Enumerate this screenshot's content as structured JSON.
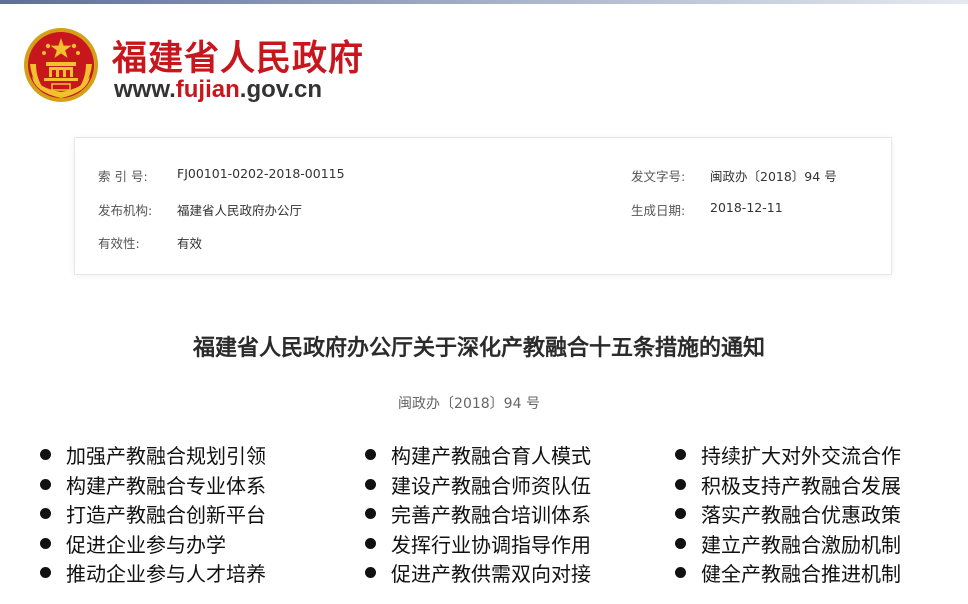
{
  "site": {
    "name": "福建省人民政府",
    "url_prefix": "www.",
    "url_accent": "fujian",
    "url_suffix": ".gov.cn"
  },
  "info": {
    "index_label": "索 引 号:",
    "index_value": "FJ00101-0202-2018-00115",
    "doc_no_label": "发文字号:",
    "doc_no_value": "闽政办〔2018〕94 号",
    "publisher_label": "发布机构:",
    "publisher_value": "福建省人民政府办公厅",
    "date_label": "生成日期:",
    "date_value": "2018-12-11",
    "validity_label": "有效性:",
    "validity_value": "有效"
  },
  "document": {
    "title": "福建省人民政府办公厅关于深化产教融合十五条措施的通知",
    "number": "闽政办〔2018〕94 号"
  },
  "measures": {
    "col1": [
      "加强产教融合规划引领",
      "构建产教融合专业体系",
      "打造产教融合创新平台",
      "促进企业参与办学",
      "推动企业参与人才培养"
    ],
    "col2": [
      "构建产教融合育人模式",
      "建设产教融合师资队伍",
      "完善产教融合培训体系",
      "发挥行业协调指导作用",
      "促进产教供需双向对接"
    ],
    "col3": [
      "持续扩大对外交流合作",
      "积极支持产教融合发展",
      "落实产教融合优惠政策",
      "建立产教融合激励机制",
      "健全产教融合推进机制"
    ]
  },
  "colors": {
    "brand_red": "#c8161d",
    "emblem_gold": "#f2c12e"
  },
  "icons": {
    "emblem": "national-emblem-icon",
    "bullet": "bullet-dot-icon"
  }
}
